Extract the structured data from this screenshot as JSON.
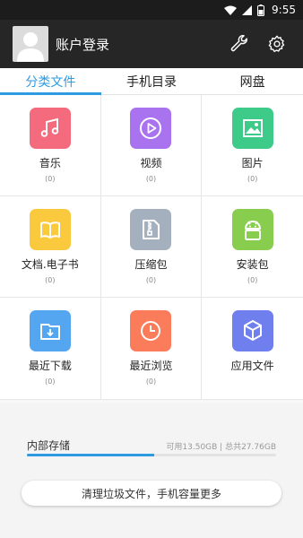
{
  "status_bar": {
    "time": "9:55"
  },
  "header": {
    "title": "账户登录"
  },
  "tabs": [
    {
      "label": "分类文件",
      "active": true
    },
    {
      "label": "手机目录",
      "active": false
    },
    {
      "label": "网盘",
      "active": false
    }
  ],
  "categories": [
    {
      "label": "音乐",
      "count": "(0)",
      "icon": "music-icon",
      "color": "#f36b7c"
    },
    {
      "label": "视频",
      "count": "(0)",
      "icon": "video-icon",
      "color": "#a972ee"
    },
    {
      "label": "图片",
      "count": "(0)",
      "icon": "image-icon",
      "color": "#3ecb8a"
    },
    {
      "label": "文档.电子书",
      "count": "(0)",
      "icon": "book-icon",
      "color": "#fbc93e"
    },
    {
      "label": "压缩包",
      "count": "(0)",
      "icon": "archive-icon",
      "color": "#a5b0bf"
    },
    {
      "label": "安装包",
      "count": "(0)",
      "icon": "android-icon",
      "color": "#89cd4e"
    },
    {
      "label": "最近下载",
      "count": "(0)",
      "icon": "download-folder-icon",
      "color": "#54a6f0"
    },
    {
      "label": "最近浏览",
      "count": "(0)",
      "icon": "clock-icon",
      "color": "#fa7c5b"
    },
    {
      "label": "应用文件",
      "count": "",
      "icon": "box-icon",
      "color": "#6f7fee"
    }
  ],
  "storage": {
    "label": "内部存储",
    "info": "可用13.50GB | 总共27.76GB",
    "used_fraction": 0.51,
    "accent": "#2e9be0"
  },
  "clean_button": {
    "label": "清理垃圾文件，手机容量更多"
  }
}
